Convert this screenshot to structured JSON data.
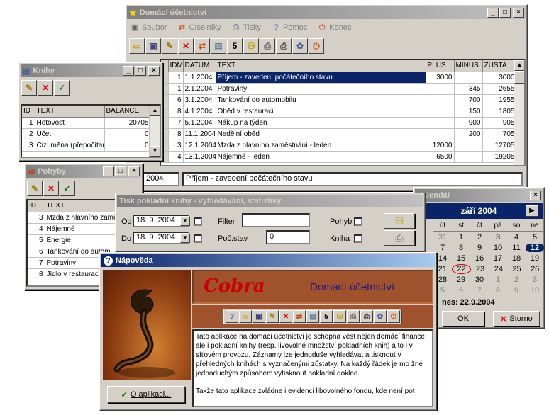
{
  "main": {
    "title": "Domácí účetnictví",
    "menu": [
      {
        "label": "Soubor",
        "icon": "disk-icon"
      },
      {
        "label": "Číselníky",
        "icon": "arrows-icon"
      },
      {
        "label": "Tisky",
        "icon": "printer-icon"
      },
      {
        "label": "Pomoc",
        "icon": "help-icon"
      },
      {
        "label": "Konec",
        "icon": "exit-icon"
      }
    ],
    "columns": [
      "IDM",
      "DATUM",
      "TEXT",
      "PLUS",
      "MINUS",
      "ZUSTA"
    ],
    "rows": [
      {
        "idm": "1",
        "datum": "1.1.2004",
        "text": "Příjem - zavedení počátečního stavu",
        "plus": "3000",
        "minus": "",
        "zust": "3000"
      },
      {
        "idm": "1",
        "datum": "2.1.2004",
        "text": "Potraviny",
        "plus": "",
        "minus": "345",
        "zust": "2655"
      },
      {
        "idm": "6",
        "datum": "3.1.2004",
        "text": "Tankování do automobilu",
        "plus": "",
        "minus": "700",
        "zust": "1955"
      },
      {
        "idm": "8",
        "datum": "4.1.2004",
        "text": "Oběd v restauraci",
        "plus": "",
        "minus": "150",
        "zust": "1805"
      },
      {
        "idm": "7",
        "datum": "5.1.2004",
        "text": "Nákup na týden",
        "plus": "",
        "minus": "900",
        "zust": "905"
      },
      {
        "idm": "8",
        "datum": "11.1.2004",
        "text": "Nedělní oběd",
        "plus": "",
        "minus": "200",
        "zust": "705"
      },
      {
        "idm": "3",
        "datum": "12.1.2004",
        "text": "Mzda z hlavního zaměstnání - leden",
        "plus": "12000",
        "minus": "",
        "zust": "12705"
      },
      {
        "idm": "4",
        "datum": "13.1.2004",
        "text": "Nájemné - leden",
        "plus": "6500",
        "minus": "",
        "zust": "19205"
      }
    ],
    "detail_date": "2004",
    "detail_text": "Příjem - zavedení počátečního stavu"
  },
  "knihy": {
    "title": "Knihy",
    "columns": [
      "ID",
      "TEXT",
      "BALANCE"
    ],
    "rows": [
      {
        "id": "1",
        "text": "Hotovost",
        "balance": "20705"
      },
      {
        "id": "2",
        "text": "Účet",
        "balance": "0"
      },
      {
        "id": "3",
        "text": "Cizí měna (přepočítaná",
        "balance": "0"
      }
    ]
  },
  "pohyby": {
    "title": "Pohyby",
    "columns": [
      "ID",
      "TEXT"
    ],
    "rows": [
      {
        "id": "3",
        "text": "Mzda z hlavního zaměs"
      },
      {
        "id": "4",
        "text": "Nájemné"
      },
      {
        "id": "5",
        "text": "Energie"
      },
      {
        "id": "6",
        "text": "Tankování do autom"
      },
      {
        "id": "7",
        "text": "Potraviny"
      },
      {
        "id": "8",
        "text": "Jídlo v restauraci."
      }
    ]
  },
  "tisk": {
    "title": "Tisk pokladní knihy - vyhledávání, statistiky",
    "od_label": "Od",
    "od_value": "18. 9 .2004",
    "do_label": "Do",
    "do_value": "18. 9 .2004",
    "filter_label": "Filter",
    "filter_value": "",
    "pocstav_label": "Poč.stav",
    "pocstav_value": "0",
    "pohyb_label": "Pohyb",
    "kniha_label": "Kniha"
  },
  "kalendar": {
    "title": "Kalendář",
    "month": "září 2004",
    "weekdays": [
      "út",
      "st",
      "čt",
      "pá",
      "so",
      "ne"
    ],
    "weeks": [
      [
        "31",
        "1",
        "2",
        "3",
        "4",
        "5"
      ],
      [
        "7",
        "8",
        "9",
        "10",
        "11",
        "12"
      ],
      [
        "14",
        "15",
        "16",
        "17",
        "18",
        "19"
      ],
      [
        "21",
        "22",
        "23",
        "24",
        "25",
        "26"
      ],
      [
        "28",
        "29",
        "30",
        "1",
        "2",
        "3"
      ],
      [
        "5",
        "6",
        "7",
        "8",
        "9",
        "10"
      ]
    ],
    "today_label": "nes: 22.9.2004",
    "ok_label": "OK",
    "storno_label": "Storno"
  },
  "napoveda": {
    "title": "Nápověda",
    "app_name": "Cobra",
    "heading": "Domácí účetnictví",
    "body1": "Tato aplikace na domácí účetnictví je schopna vést nejen domácí finance, ale i pokladní knihy (resp. livovolné množství pokladních knih) a to i v síťovém provozu. Záznamy lze jednoduše vyhledávat a tisknout v přehledných knihách s vyznačenými zůstatky. Na každý řádek je mo žné jednoduchým způsobem vytisknout pokladní doklad.",
    "body2": "Takže tato aplikace zvládne i evidenci libovolného fondu, kde není pot",
    "about_label": "O aplikaci..."
  },
  "colors": {
    "title_active": "#0a246a",
    "title_inactive": "#808080",
    "cobra_red": "#cc0000",
    "heading_blue": "#1a1a8c",
    "brown_panel": "#a0522d"
  }
}
